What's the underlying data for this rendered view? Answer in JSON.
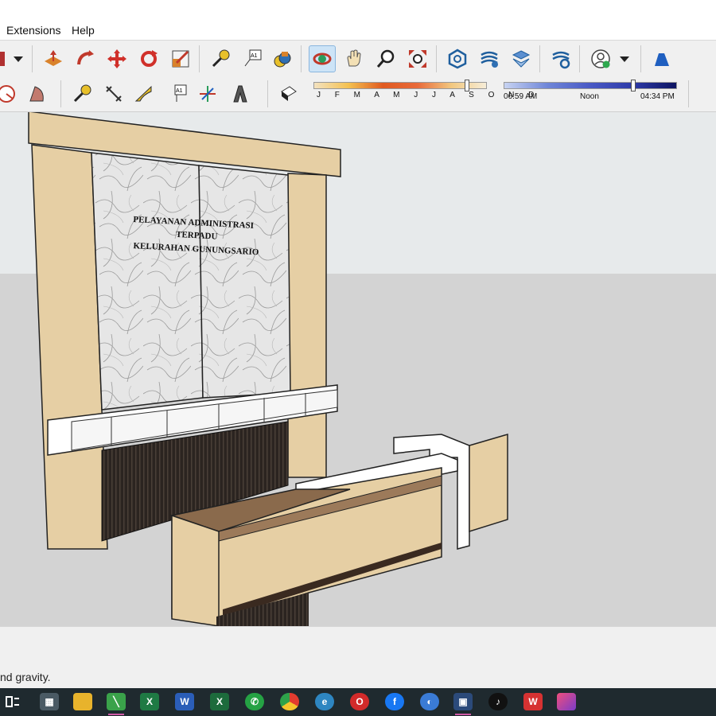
{
  "menu": {
    "items": [
      "Extensions",
      "Help"
    ]
  },
  "toolbar_top": {
    "icons": [
      "dropdown-arrow-icon",
      "push-pull-icon",
      "follow-me-icon",
      "move-icon",
      "rotate-icon",
      "scale-icon",
      "tape-measure-icon",
      "text-label-icon",
      "paint-bucket-icon",
      "orbit-icon",
      "pan-icon",
      "zoom-icon",
      "zoom-extents-icon",
      "warehouse-icon",
      "warehouse-share-icon",
      "extension-warehouse-icon",
      "extension-manager-icon",
      "account-icon",
      "layout-icon"
    ]
  },
  "toolbar_bottom": {
    "shadow_months": "J F M A M J J A S O N D",
    "time_start": "06:59 AM",
    "time_mid": "Noon",
    "time_end": "04:34 PM",
    "date_level": 0.88,
    "time_level": 0.74
  },
  "model": {
    "sign_line1": "PELAYANAN ADMINISTRASI",
    "sign_line2": "TERPADU",
    "sign_line3": "KELURAHAN GUNUNGSARIO"
  },
  "status": {
    "text": "nd gravity."
  },
  "taskbar": {
    "icons": [
      "task-view-icon",
      "calculator-icon",
      "file-explorer-icon",
      "sketchup-icon",
      "excel-icon",
      "word-icon",
      "excel-2-icon",
      "whatsapp-icon",
      "chrome-icon",
      "edge-icon",
      "opera-icon",
      "facebook-icon",
      "signal-icon",
      "sketchup-running-icon",
      "tiktok-icon",
      "wps-icon",
      "app-icon"
    ]
  },
  "colors": {
    "wood": "#e6cfa4",
    "dark": "#2b2420",
    "marble": "#e4e4e4",
    "ground": "#d3d3d3",
    "sky": "#e7eaeb"
  }
}
